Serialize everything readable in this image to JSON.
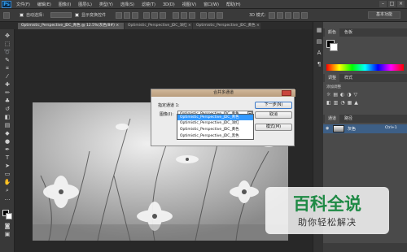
{
  "menubar": {
    "logo": "Ps",
    "items": [
      "文件(F)",
      "编辑(E)",
      "图像(I)",
      "图层(L)",
      "类型(Y)",
      "选择(S)",
      "滤镜(T)",
      "3D(D)",
      "视图(V)",
      "窗口(W)",
      "帮助(H)"
    ]
  },
  "options": {
    "auto_select": "自动选择：",
    "show_transform": "显示变换控件",
    "mode_3d": "3D 模式：",
    "workspace": "基本功能"
  },
  "tabs": [
    "Optimistic_Perspective_JDC_青色 @ 12.5%(灰色/8#) ×",
    "Optimistic_Perspective_JDC_洋红 ×",
    "Optimistic_Perspective_JDC_黄色 ×"
  ],
  "panels": {
    "color_tab": "颜色",
    "swatches_tab": "色板",
    "adjust_tab": "调整",
    "styles_tab": "样式",
    "adjust_title": "添加调整",
    "layers_tab": "通道",
    "paths_tab": "路径",
    "layer_name": "灰色",
    "layer_shortcut": "Ctrl+1"
  },
  "dialog": {
    "title": "合并多通道",
    "channel_label": "指定通道 1:",
    "channel_value": "",
    "image_label": "图像(I):",
    "image_value": "Optimistic_Perspective_JDC_青色",
    "next_button": "下一步(N)",
    "cancel_button": "取消",
    "mode_button": "模式(M)",
    "dropdown_options": [
      "Optimistic_Perspective_JDC_青色",
      "Optimistic_Perspective_JDC_洋红",
      "Optimistic_Perspective_JDC_黄色",
      "Optimistic_Perspective_JDC_黑色"
    ]
  },
  "watermark": {
    "title": "百科全说",
    "subtitle": "助你轻松解决"
  },
  "colors": {
    "accent": "#31a8ff",
    "selection": "#3399ff",
    "watermark_green": "#1f8a45"
  }
}
